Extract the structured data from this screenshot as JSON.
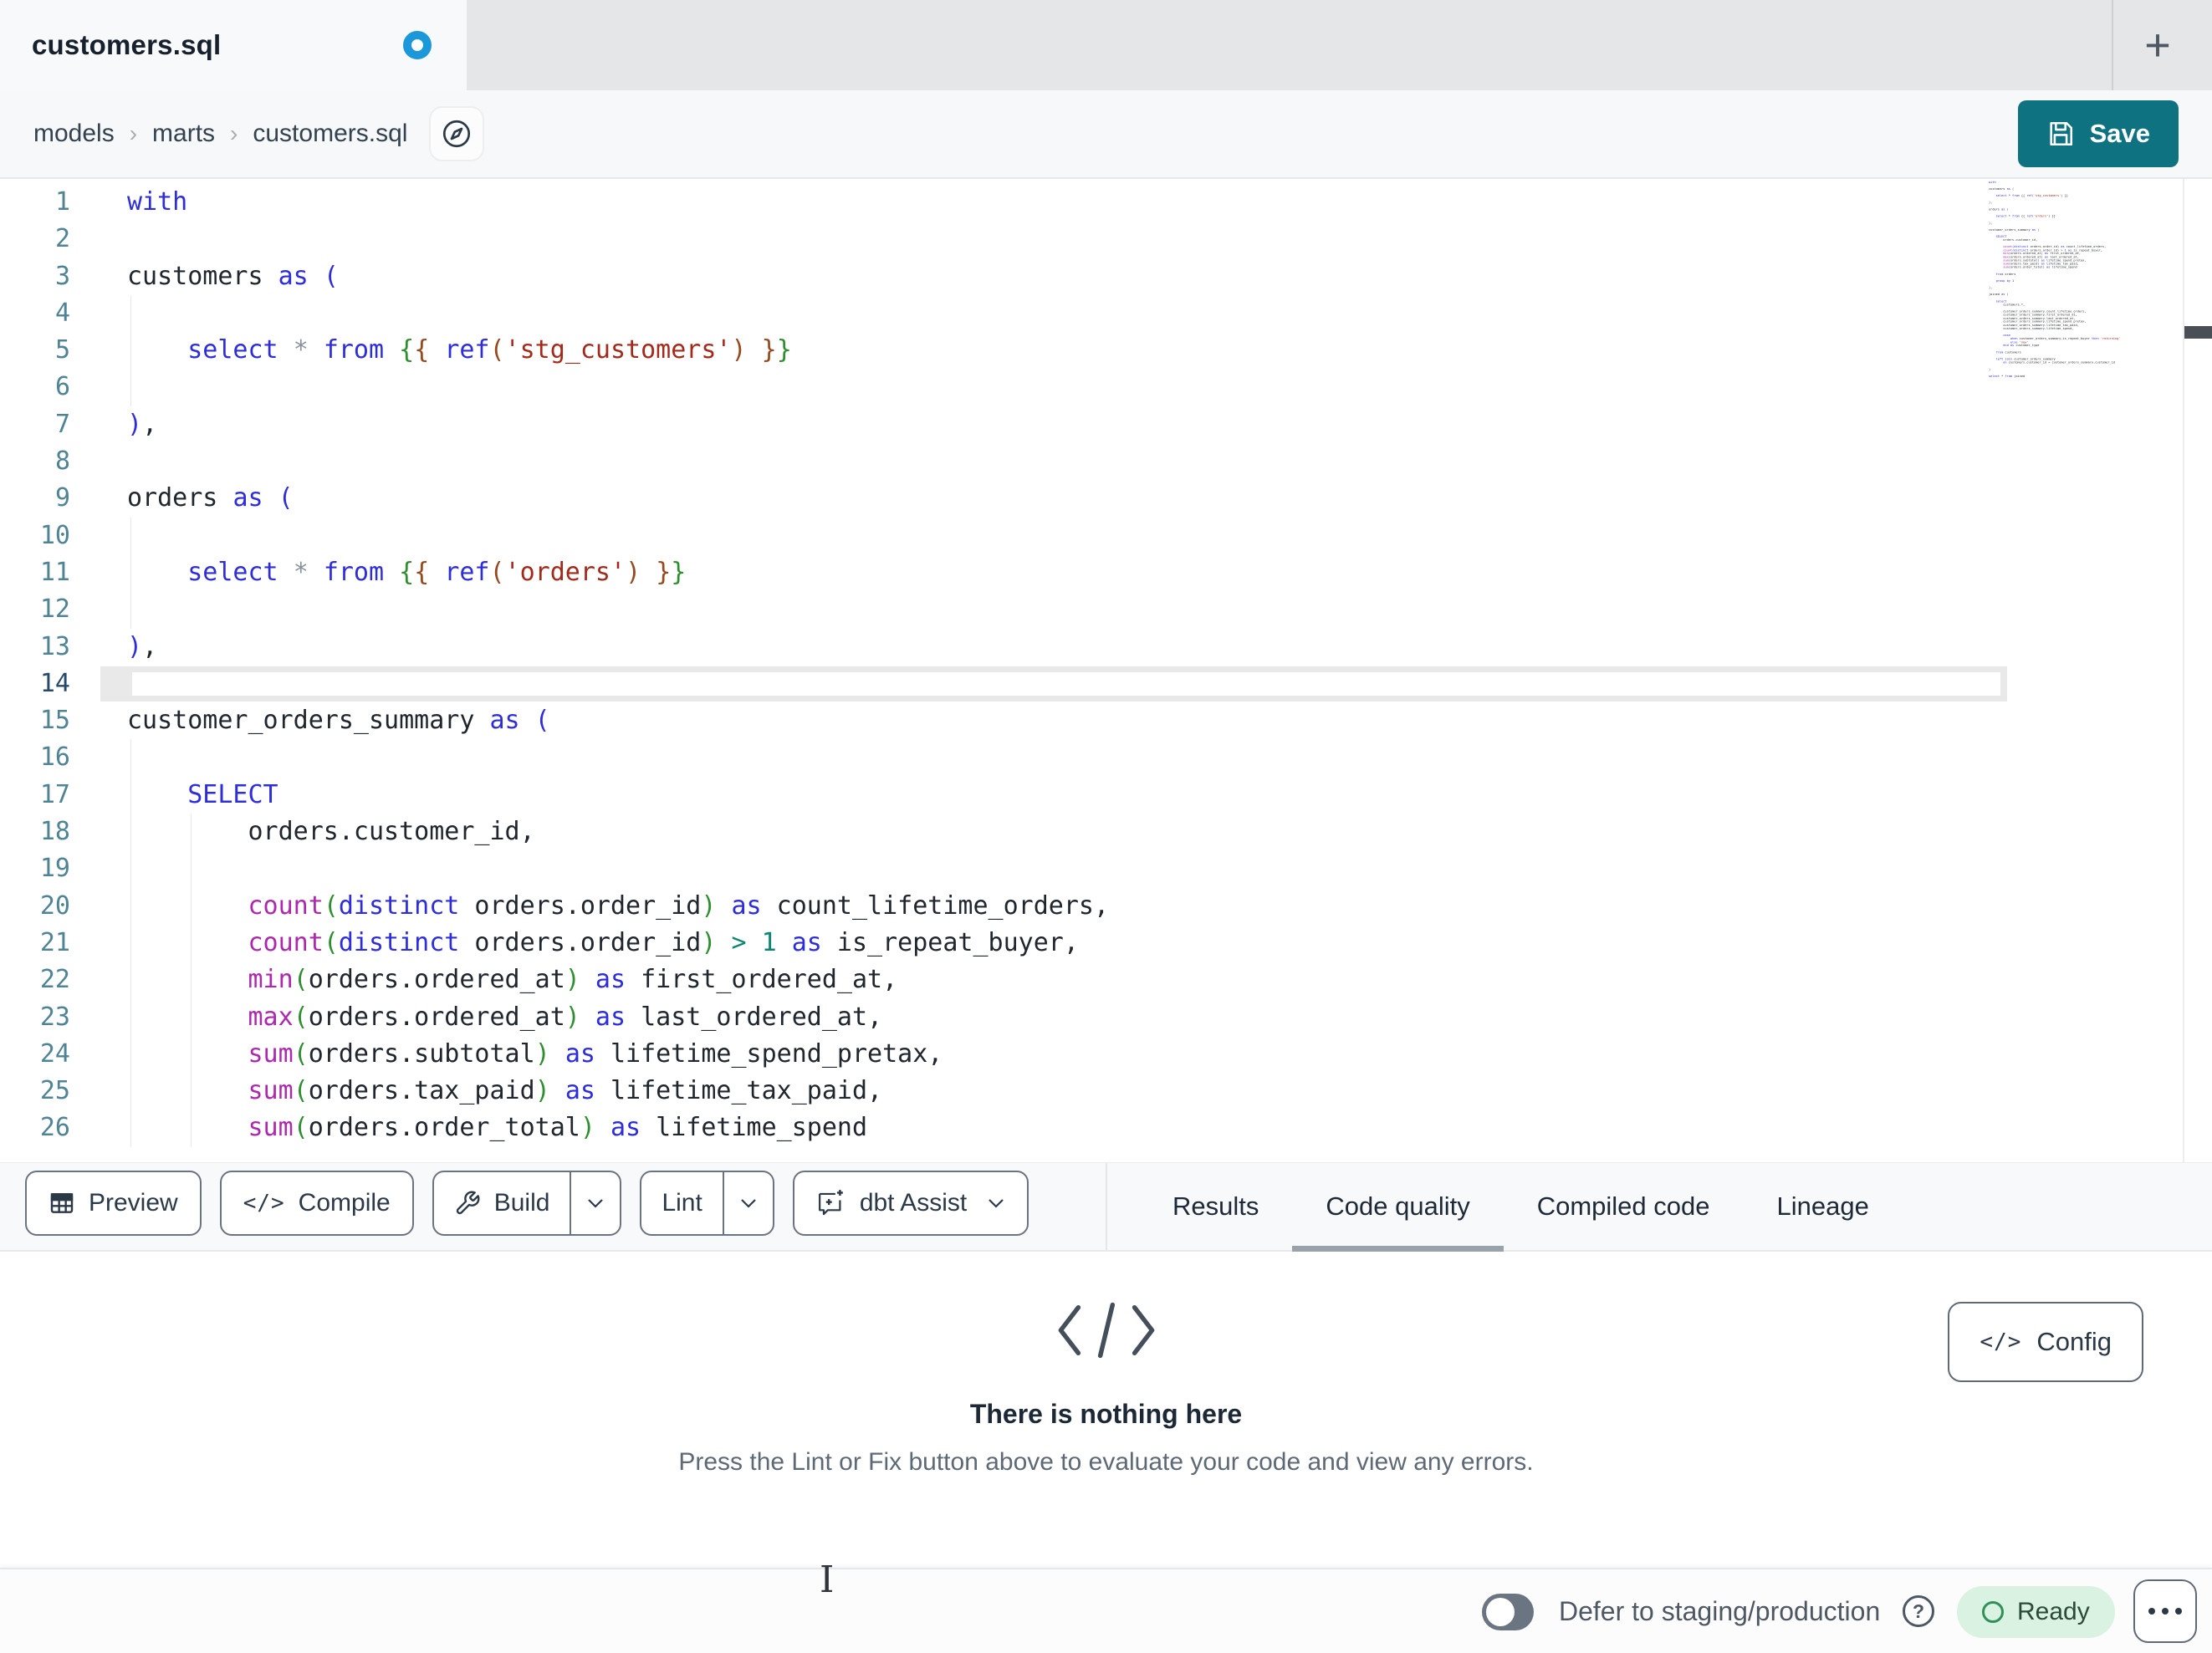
{
  "tab_bar": {
    "tabs": [
      {
        "label": "customers.sql",
        "active": true,
        "unsaved": true
      }
    ],
    "new_tab_label": "+"
  },
  "breadcrumb": {
    "items": [
      "models",
      "marts",
      "customers.sql"
    ],
    "separator": "›"
  },
  "header": {
    "save_label": "Save"
  },
  "editor": {
    "language": "sql",
    "active_line": 14,
    "lines": [
      {
        "n": 1,
        "tokens": [
          [
            "kw",
            "with"
          ]
        ]
      },
      {
        "n": 2,
        "tokens": []
      },
      {
        "n": 3,
        "tokens": [
          [
            "id",
            "customers "
          ],
          [
            "kw",
            "as"
          ],
          [
            "id",
            " "
          ],
          [
            "b1",
            "("
          ]
        ]
      },
      {
        "n": 4,
        "guides": [
          1
        ],
        "tokens": []
      },
      {
        "n": 5,
        "guides": [
          1
        ],
        "tokens": [
          [
            "ws",
            "    "
          ],
          [
            "kw",
            "select"
          ],
          [
            "id",
            " "
          ],
          [
            "op",
            "*"
          ],
          [
            "id",
            " "
          ],
          [
            "kw",
            "from"
          ],
          [
            "id",
            " "
          ],
          [
            "b2",
            "{"
          ],
          [
            "b3",
            "{"
          ],
          [
            "id",
            " "
          ],
          [
            "kw",
            "ref"
          ],
          [
            "b3",
            "("
          ],
          [
            "str",
            "'stg_customers'"
          ],
          [
            "b3",
            ")"
          ],
          [
            "id",
            " "
          ],
          [
            "b3",
            "}"
          ],
          [
            "b2",
            "}"
          ]
        ]
      },
      {
        "n": 6,
        "guides": [
          1
        ],
        "tokens": []
      },
      {
        "n": 7,
        "tokens": [
          [
            "b1",
            ")"
          ],
          [
            "id",
            ","
          ]
        ]
      },
      {
        "n": 8,
        "tokens": []
      },
      {
        "n": 9,
        "tokens": [
          [
            "id",
            "orders "
          ],
          [
            "kw",
            "as"
          ],
          [
            "id",
            " "
          ],
          [
            "b1",
            "("
          ]
        ]
      },
      {
        "n": 10,
        "guides": [
          1
        ],
        "tokens": []
      },
      {
        "n": 11,
        "guides": [
          1
        ],
        "tokens": [
          [
            "ws",
            "    "
          ],
          [
            "kw",
            "select"
          ],
          [
            "id",
            " "
          ],
          [
            "op",
            "*"
          ],
          [
            "id",
            " "
          ],
          [
            "kw",
            "from"
          ],
          [
            "id",
            " "
          ],
          [
            "b2",
            "{"
          ],
          [
            "b3",
            "{"
          ],
          [
            "id",
            " "
          ],
          [
            "kw",
            "ref"
          ],
          [
            "b3",
            "("
          ],
          [
            "str",
            "'orders'"
          ],
          [
            "b3",
            ")"
          ],
          [
            "id",
            " "
          ],
          [
            "b3",
            "}"
          ],
          [
            "b2",
            "}"
          ]
        ]
      },
      {
        "n": 12,
        "guides": [
          1
        ],
        "tokens": []
      },
      {
        "n": 13,
        "tokens": [
          [
            "b1",
            ")"
          ],
          [
            "id",
            ","
          ]
        ]
      },
      {
        "n": 14,
        "tokens": []
      },
      {
        "n": 15,
        "tokens": [
          [
            "id",
            "customer_orders_summary "
          ],
          [
            "kw",
            "as"
          ],
          [
            "id",
            " "
          ],
          [
            "b1",
            "("
          ]
        ]
      },
      {
        "n": 16,
        "guides": [
          1
        ],
        "tokens": []
      },
      {
        "n": 17,
        "guides": [
          1
        ],
        "tokens": [
          [
            "ws",
            "    "
          ],
          [
            "kw",
            "SELECT"
          ]
        ]
      },
      {
        "n": 18,
        "guides": [
          1,
          2
        ],
        "tokens": [
          [
            "ws",
            "        "
          ],
          [
            "id",
            "orders.customer_id,"
          ]
        ]
      },
      {
        "n": 19,
        "guides": [
          1,
          2
        ],
        "tokens": []
      },
      {
        "n": 20,
        "guides": [
          1,
          2
        ],
        "tokens": [
          [
            "ws",
            "        "
          ],
          [
            "fn",
            "count"
          ],
          [
            "b2",
            "("
          ],
          [
            "kw",
            "distinct"
          ],
          [
            "id",
            " orders.order_id"
          ],
          [
            "b2",
            ")"
          ],
          [
            "id",
            " "
          ],
          [
            "kw",
            "as"
          ],
          [
            "id",
            " count_lifetime_orders,"
          ]
        ]
      },
      {
        "n": 21,
        "guides": [
          1,
          2
        ],
        "tokens": [
          [
            "ws",
            "        "
          ],
          [
            "fn",
            "count"
          ],
          [
            "b2",
            "("
          ],
          [
            "kw",
            "distinct"
          ],
          [
            "id",
            " orders.order_id"
          ],
          [
            "b2",
            ")"
          ],
          [
            "id",
            " "
          ],
          [
            "num",
            ">"
          ],
          [
            "id",
            " "
          ],
          [
            "num",
            "1"
          ],
          [
            "id",
            " "
          ],
          [
            "kw",
            "as"
          ],
          [
            "id",
            " is_repeat_buyer,"
          ]
        ]
      },
      {
        "n": 22,
        "guides": [
          1,
          2
        ],
        "tokens": [
          [
            "ws",
            "        "
          ],
          [
            "fn",
            "min"
          ],
          [
            "b2",
            "("
          ],
          [
            "id",
            "orders.ordered_at"
          ],
          [
            "b2",
            ")"
          ],
          [
            "id",
            " "
          ],
          [
            "kw",
            "as"
          ],
          [
            "id",
            " first_ordered_at,"
          ]
        ]
      },
      {
        "n": 23,
        "guides": [
          1,
          2
        ],
        "tokens": [
          [
            "ws",
            "        "
          ],
          [
            "fn",
            "max"
          ],
          [
            "b2",
            "("
          ],
          [
            "id",
            "orders.ordered_at"
          ],
          [
            "b2",
            ")"
          ],
          [
            "id",
            " "
          ],
          [
            "kw",
            "as"
          ],
          [
            "id",
            " last_ordered_at,"
          ]
        ]
      },
      {
        "n": 24,
        "guides": [
          1,
          2
        ],
        "tokens": [
          [
            "ws",
            "        "
          ],
          [
            "fn",
            "sum"
          ],
          [
            "b2",
            "("
          ],
          [
            "id",
            "orders.subtotal"
          ],
          [
            "b2",
            ")"
          ],
          [
            "id",
            " "
          ],
          [
            "kw",
            "as"
          ],
          [
            "id",
            " lifetime_spend_pretax,"
          ]
        ]
      },
      {
        "n": 25,
        "guides": [
          1,
          2
        ],
        "tokens": [
          [
            "ws",
            "        "
          ],
          [
            "fn",
            "sum"
          ],
          [
            "b2",
            "("
          ],
          [
            "id",
            "orders.tax_paid"
          ],
          [
            "b2",
            ")"
          ],
          [
            "id",
            " "
          ],
          [
            "kw",
            "as"
          ],
          [
            "id",
            " lifetime_tax_paid,"
          ]
        ]
      },
      {
        "n": 26,
        "guides": [
          1,
          2
        ],
        "tokens": [
          [
            "ws",
            "        "
          ],
          [
            "fn",
            "sum"
          ],
          [
            "b2",
            "("
          ],
          [
            "id",
            "orders.order_total"
          ],
          [
            "b2",
            ")"
          ],
          [
            "id",
            " "
          ],
          [
            "kw",
            "as"
          ],
          [
            "id",
            " lifetime_spend"
          ]
        ]
      }
    ],
    "minimap_text": "with\n\ncustomers as (\n\n    select * from {{ ref('stg_customers') }}\n\n),\n\norders as (\n\n    select * from {{ ref('orders') }}\n\n),\n\ncustomer_orders_summary as (\n\n    SELECT\n        orders.customer_id,\n\n        count(distinct orders.order_id) as count_lifetime_orders,\n        count(distinct orders.order_id) > 1 as is_repeat_buyer,\n        min(orders.ordered_at) as first_ordered_at,\n        max(orders.ordered_at) as last_ordered_at,\n        sum(orders.subtotal) as lifetime_spend_pretax,\n        sum(orders.tax_paid) as lifetime_tax_paid,\n        sum(orders.order_total) as lifetime_spend\n\n    from orders\n\n    group by 1\n\n),\n\njoined as (\n\n    select\n        customers.*,\n\n        customer_orders_summary.count_lifetime_orders,\n        customer_orders_summary.first_ordered_at,\n        customer_orders_summary.last_ordered_at,\n        customer_orders_summary.lifetime_spend_pretax,\n        customer_orders_summary.lifetime_tax_paid,\n        customer_orders_summary.lifetime_spend,\n\n        case\n            when customer_orders_summary.is_repeat_buyer then 'returning'\n            else 'new'\n        end as customer_type\n\n    from customers\n\n    left join customer_orders_summary\n        on customers.customer_id = customer_orders_summary.customer_id\n\n)\n\nselect * from joined"
  },
  "toolbar": {
    "preview_label": "Preview",
    "compile_label": "Compile",
    "build_label": "Build",
    "lint_label": "Lint",
    "assist_label": "dbt Assist",
    "compile_glyph": "</>"
  },
  "panel_tabs": [
    {
      "label": "Results",
      "active": false
    },
    {
      "label": "Code quality",
      "active": true
    },
    {
      "label": "Compiled code",
      "active": false
    },
    {
      "label": "Lineage",
      "active": false
    }
  ],
  "results_panel": {
    "empty_title": "There is nothing here",
    "empty_subtitle": "Press the Lint or Fix button above to evaluate your code and view any errors.",
    "config_label": "Config",
    "config_glyph": "</>"
  },
  "status_bar": {
    "defer_label": "Defer to staging/production",
    "defer_enabled": false,
    "ready_label": "Ready",
    "help_glyph": "?"
  },
  "colors": {
    "accent_teal": "#0f7280",
    "tab_dot_blue": "#1b98d9",
    "ready_bg": "#d9f2e2",
    "ready_green": "#2f9058",
    "keyword": "#2d2ddb",
    "function": "#ad28ad",
    "string": "#a32a1b",
    "bracket_l1": "#2d2ddb",
    "bracket_l2": "#2e8f2e",
    "bracket_l3": "#96491f",
    "number": "#0e8573",
    "line_number": "#4f8494",
    "active_line_bg": "#e9e9e9"
  }
}
